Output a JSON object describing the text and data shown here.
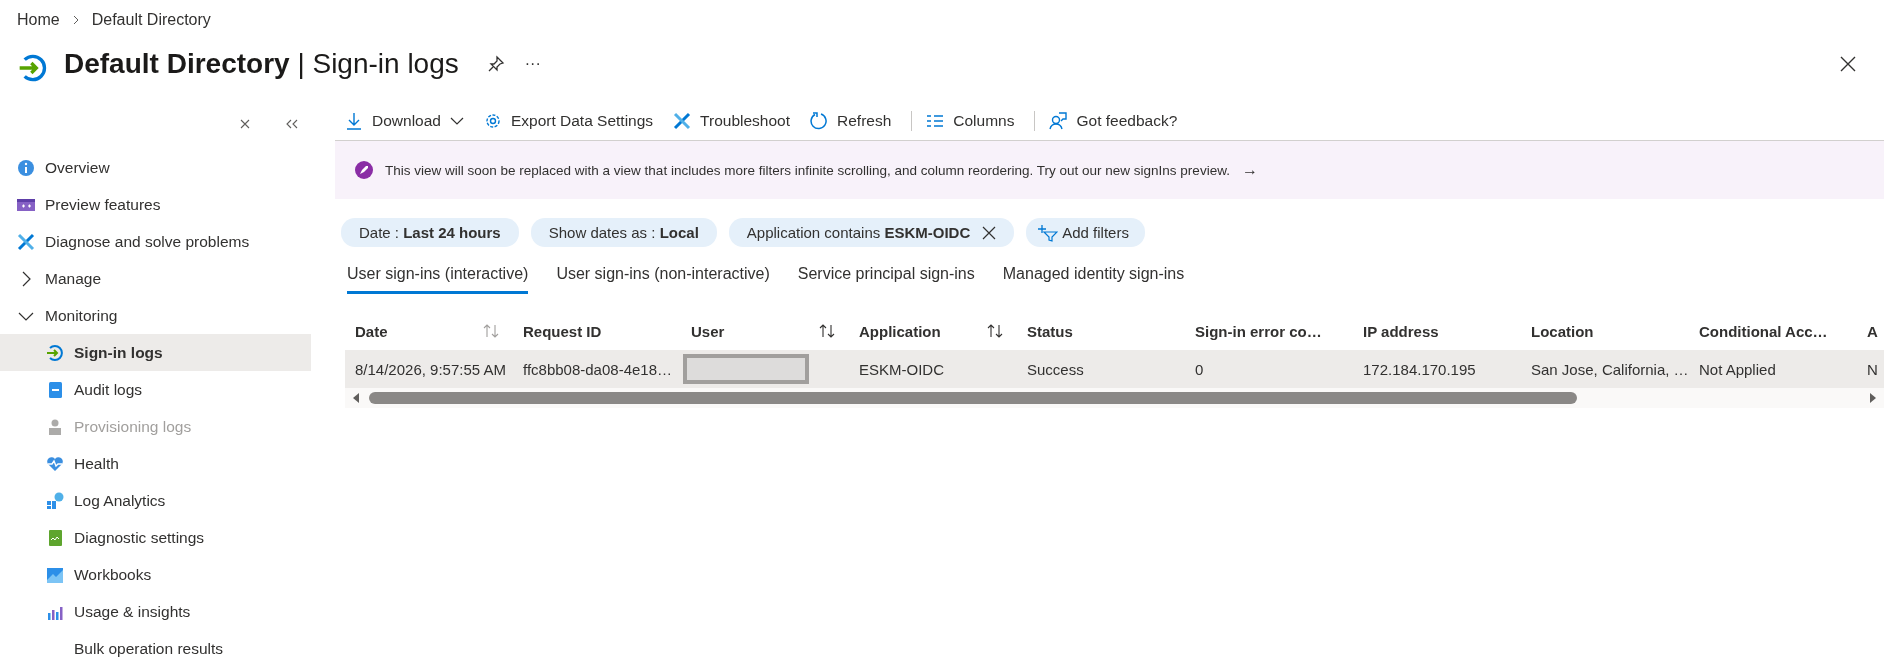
{
  "breadcrumb": [
    "Home",
    "Default Directory"
  ],
  "title": "**Default Directory** | Sign-in logs",
  "title_actions": {
    "more": "···"
  },
  "sidebar": {
    "items": [
      {
        "kind": "item",
        "label": "Overview",
        "selected": false,
        "disabled": false
      },
      {
        "kind": "item",
        "label": "Preview features",
        "selected": false,
        "disabled": false
      },
      {
        "kind": "item",
        "label": "Diagnose and solve problems",
        "selected": false,
        "disabled": false
      },
      {
        "kind": "group",
        "label": "Manage",
        "expanded": false
      },
      {
        "kind": "group",
        "label": "Monitoring",
        "expanded": true,
        "children": [
          {
            "label": "Sign-in logs",
            "selected": true,
            "disabled": false
          },
          {
            "label": "Audit logs",
            "selected": false,
            "disabled": false
          },
          {
            "label": "Provisioning logs",
            "selected": false,
            "disabled": true
          },
          {
            "label": "Health",
            "selected": false,
            "disabled": false
          },
          {
            "label": "Log Analytics",
            "selected": false,
            "disabled": false
          },
          {
            "label": "Diagnostic settings",
            "selected": false,
            "disabled": false
          },
          {
            "label": "Workbooks",
            "selected": false,
            "disabled": false
          },
          {
            "label": "Usage & insights",
            "selected": false,
            "disabled": false
          },
          {
            "label": "Bulk operation results",
            "selected": false,
            "disabled": false
          }
        ]
      }
    ]
  },
  "toolbar": [
    {
      "kind": "button",
      "label": "Download",
      "dropdown": true
    },
    {
      "kind": "button",
      "label": "Export Data Settings",
      "dropdown": false
    },
    {
      "kind": "button",
      "label": "Troubleshoot",
      "dropdown": false
    },
    {
      "kind": "button",
      "label": "Refresh",
      "dropdown": false
    },
    {
      "kind": "separator"
    },
    {
      "kind": "button",
      "label": "Columns",
      "dropdown": false
    },
    {
      "kind": "separator"
    },
    {
      "kind": "button",
      "label": "Got feedback?",
      "dropdown": false
    }
  ],
  "banner": {
    "text": "This view will soon be replaced with a view that includes more filters infinite scrolling, and column reordering. Try out our new signIns preview.",
    "arrow": "→"
  },
  "filters": [
    {
      "text": "Date : **Last 24 hours**",
      "removable": false
    },
    {
      "text": "Show dates as : **Local**",
      "removable": false
    },
    {
      "text": "Application contains **ESKM-OIDC**",
      "removable": true
    }
  ],
  "add_filter": "Add filters",
  "tabs": [
    {
      "label": "User sign-ins (interactive)",
      "selected": true
    },
    {
      "label": "User sign-ins (non-interactive)",
      "selected": false
    },
    {
      "label": "Service principal sign-ins",
      "selected": false
    },
    {
      "label": "Managed identity sign-ins",
      "selected": false
    }
  ],
  "table": {
    "columns": [
      {
        "label": "Date",
        "sortable": true
      },
      {
        "label": "Request ID",
        "sortable": false
      },
      {
        "label": "User",
        "sortable": true
      },
      {
        "label": "Application",
        "sortable": true
      },
      {
        "label": "Status",
        "sortable": false
      },
      {
        "label": "Sign-in error co…",
        "sortable": false
      },
      {
        "label": "IP address",
        "sortable": false
      },
      {
        "label": "Location",
        "sortable": false
      },
      {
        "label": "Conditional Acc…",
        "sortable": false
      },
      {
        "label": "A"
      }
    ],
    "rows": [
      {
        "selected": true,
        "cells": [
          {
            "kind": "text",
            "text": "8/14/2026, 9:57:55 AM"
          },
          {
            "kind": "text",
            "text": "ffc8bb08-da08-4e18…"
          },
          {
            "kind": "redacted"
          },
          {
            "kind": "text",
            "text": "ESKM-OIDC"
          },
          {
            "kind": "text",
            "text": "Success"
          },
          {
            "kind": "text",
            "text": "0"
          },
          {
            "kind": "text",
            "text": "172.184.170.195"
          },
          {
            "kind": "text",
            "text": "San Jose, California, …"
          },
          {
            "kind": "text",
            "text": "Not Applied"
          },
          {
            "kind": "text",
            "text": "N"
          }
        ]
      }
    ]
  }
}
